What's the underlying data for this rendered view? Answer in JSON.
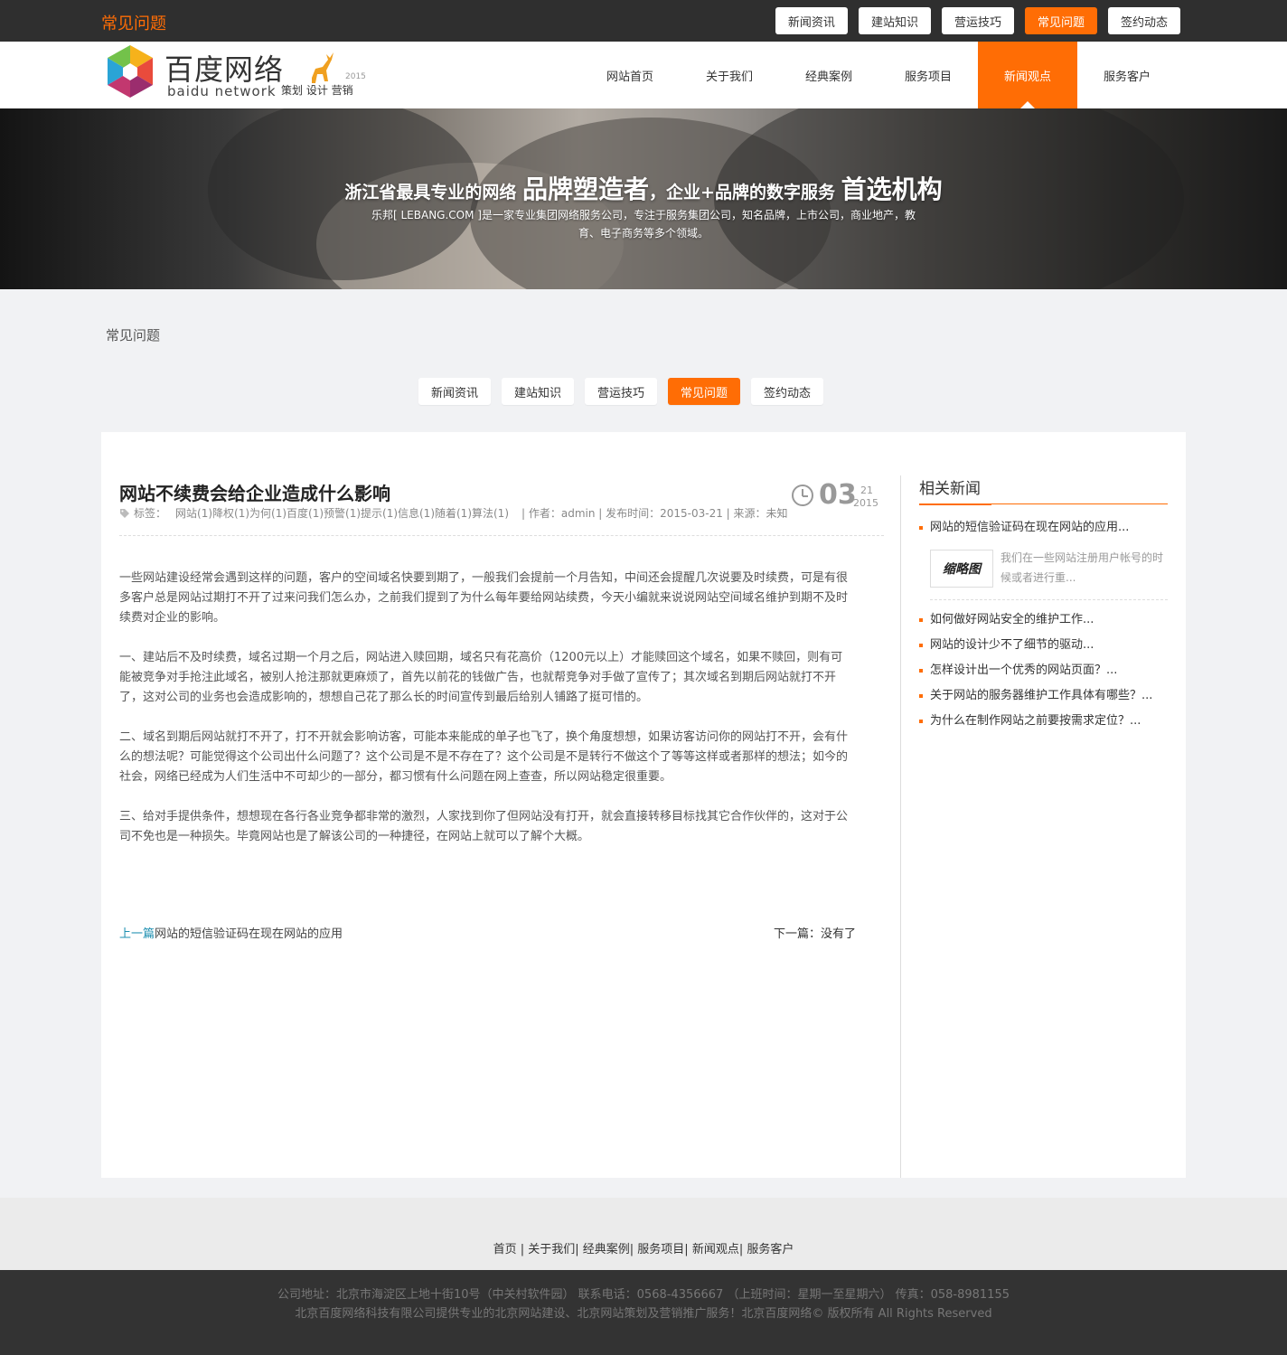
{
  "top": {
    "page_title": "常见问题",
    "tabs": [
      {
        "label": "新闻资讯",
        "active": false
      },
      {
        "label": "建站知识",
        "active": false
      },
      {
        "label": "营运技巧",
        "active": false
      },
      {
        "label": "常见问题",
        "active": true
      },
      {
        "label": "签约动态",
        "active": false
      }
    ]
  },
  "logo": {
    "name_cn": "百度网络",
    "name_en": "baidu network",
    "slogan": "策划 设计 营销",
    "year": "2015"
  },
  "nav": [
    {
      "label": "网站首页",
      "active": false
    },
    {
      "label": "关于我们",
      "active": false
    },
    {
      "label": "经典案例",
      "active": false
    },
    {
      "label": "服务项目",
      "active": false
    },
    {
      "label": "新闻观点",
      "active": true
    },
    {
      "label": "服务客户",
      "active": false
    }
  ],
  "banner": {
    "h_part1": "浙江省最具专业的网络 ",
    "h_big1": "品牌塑造者",
    "h_part2": "，企业+品牌的数字服务 ",
    "h_big2": "首选机构",
    "desc": "乐邦[ LEBANG.COM ]是一家专业集团网络服务公司，专注于服务集团公司，知名品牌，上市公司，商业地产，教育、电子商务等多个领域。"
  },
  "breadcrumb": "常见问题",
  "subtabs": [
    {
      "label": "新闻资讯",
      "active": false
    },
    {
      "label": "建站知识",
      "active": false
    },
    {
      "label": "营运技巧",
      "active": false
    },
    {
      "label": "常见问题",
      "active": true
    },
    {
      "label": "签约动态",
      "active": false
    }
  ],
  "article": {
    "title": "网站不续费会给企业造成什么影响",
    "tags_label": "标签：",
    "tags": "网站(1)降权(1)为何(1)百度(1)预警(1)提示(1)信息(1)随着(1)算法(1)",
    "meta": "| 作者：admin | 发布时间：2015-03-21 | 来源：未知",
    "date_day": "03",
    "date_month": "21",
    "date_year": "2015",
    "paragraphs": [
      "一些网站建设经常会遇到这样的问题，客户的空间域名快要到期了，一般我们会提前一个月告知，中间还会提醒几次说要及时续费，可是有很多客户总是网站过期打不开了过来问我们怎么办，之前我们提到了为什么每年要给网站续费，今天小编就来说说网站空间域名维护到期不及时续费对企业的影响。",
      "一、建站后不及时续费，域名过期一个月之后，网站进入赎回期，域名只有花高价（1200元以上）才能赎回这个域名，如果不赎回，则有可能被竞争对手抢注此域名，被别人抢注那就更麻烦了，首先以前花的钱做广告，也就帮竞争对手做了宣传了；其次域名到期后网站就打不开了，这对公司的业务也会造成影响的，想想自己花了那么长的时间宣传到最后给别人铺路了挺可惜的。",
      "二、域名到期后网站就打不开了，打不开就会影响访客，可能本来能成的单子也飞了，换个角度想想，如果访客访问你的网站打不开，会有什么的想法呢？可能觉得这个公司出什么问题了？这个公司是不是不存在了？这个公司是不是转行不做这个了等等这样或者那样的想法；如今的社会，网络已经成为人们生活中不可却少的一部分，都习惯有什么问题在网上查查，所以网站稳定很重要。",
      "三、给对手提供条件，想想现在各行各业竞争都非常的激烈，人家找到你了但网站没有打开，就会直接转移目标找其它合作伙伴的，这对于公司不免也是一种损失。毕竟网站也是了解该公司的一种捷径，在网站上就可以了解个大概。"
    ],
    "prev_label": "上一篇",
    "prev_title": "网站的短信验证码在现在网站的应用",
    "next_text": "下一篇：没有了"
  },
  "sidebar": {
    "heading": "相关新闻",
    "first_item": "网站的短信验证码在现在网站的应用...",
    "feature_thumb": "缩略图",
    "feature_desc": "我们在一些网站注册用户帐号的时候或者进行重...",
    "items": [
      "如何做好网站安全的维护工作...",
      "网站的设计少不了细节的驱动...",
      "怎样设计出一个优秀的网站页面？...",
      "关于网站的服务器维护工作具体有哪些？...",
      "为什么在制作网站之前要按需求定位？..."
    ]
  },
  "footer": {
    "links": "首页 | 关于我们| 经典案例| 服务项目| 新闻观点| 服务客户",
    "line1": "公司地址：北京市海淀区上地十街10号（中关村软件园） 联系电话：0568-4356667 （上班时间：星期一至星期六） 传真：058-8981155",
    "line2": "北京百度网络科技有限公司提供专业的北京网站建设、北京网站策划及营销推广服务！北京百度网络© 版权所有 All Rights Reserved"
  },
  "colors": {
    "accent": "#ff6d05",
    "topbar": "#2f2f2f",
    "footer": "#333333",
    "link": "#1d8fb0"
  }
}
